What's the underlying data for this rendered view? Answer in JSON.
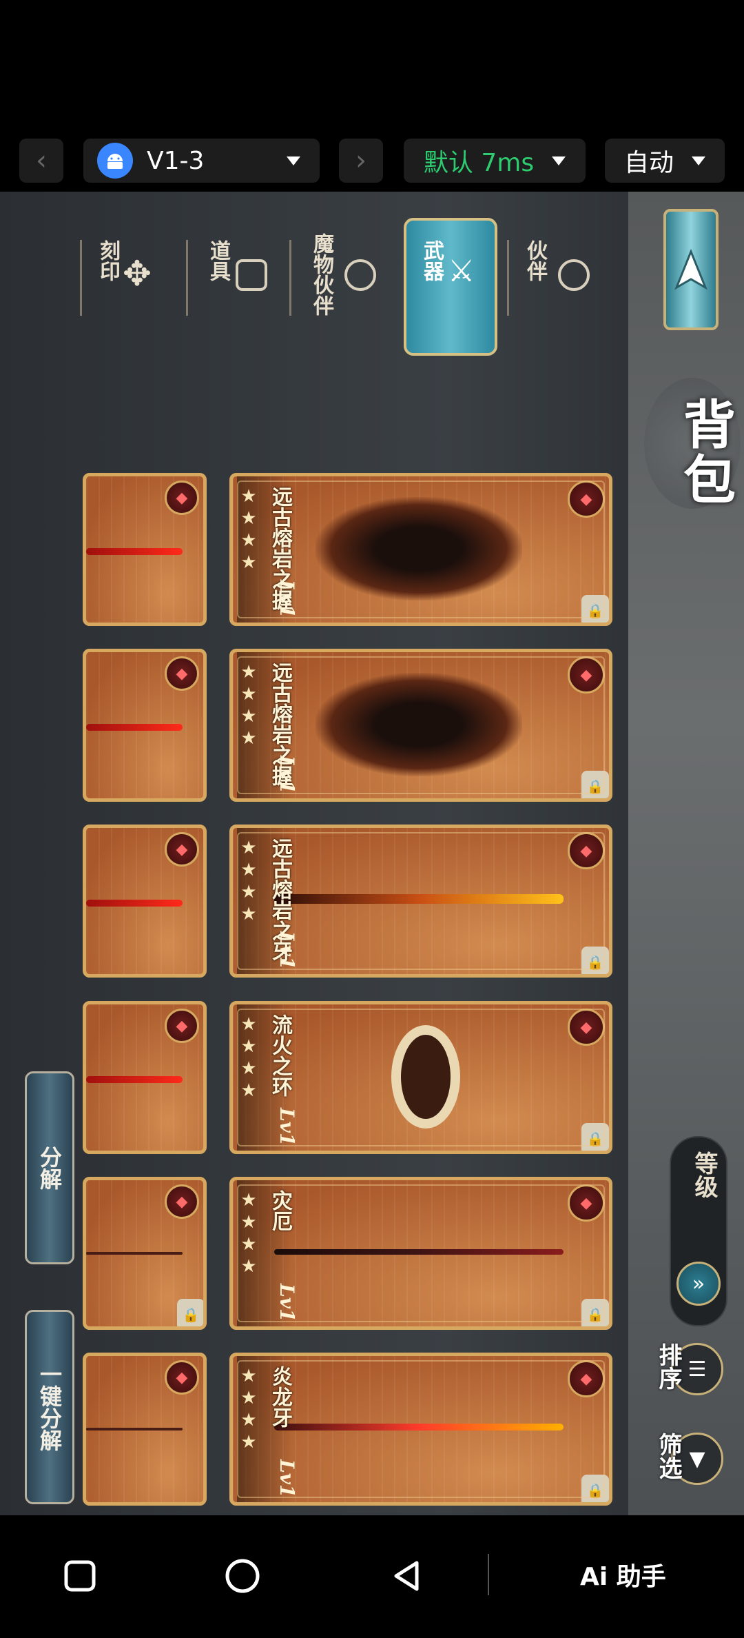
{
  "toolbar": {
    "prev_icon": "chevron-left-icon",
    "next_icon": "chevron-right-icon",
    "device": "V1-3",
    "latency": "默认 7ms",
    "mode": "自动"
  },
  "game": {
    "title": "背包",
    "tabs": [
      {
        "label": "伙伴",
        "icon": "partner-icon"
      },
      {
        "label": "武器",
        "icon": "crossed-swords-icon",
        "selected": true
      },
      {
        "label": "魔物伙伴",
        "icon": "beast-icon"
      },
      {
        "label": "道具",
        "icon": "item-icon"
      },
      {
        "label": "刻印",
        "icon": "rune-icon"
      }
    ],
    "sort": {
      "level_label": "等级",
      "sort_label": "排序",
      "filter_label": "筛选"
    },
    "items": [
      {
        "name": "远古熔岩之握",
        "level": "Lv1",
        "stars": "★★★★",
        "art": "gauntlet",
        "locked": true
      },
      {
        "name": "远古熔岩之握",
        "level": "Lv1",
        "stars": "★★★★",
        "art": "gauntlet",
        "locked": true
      },
      {
        "name": "远古熔岩之牙",
        "level": "Lv1",
        "stars": "★★★★",
        "art": "blade",
        "locked": true
      },
      {
        "name": "流火之环",
        "level": "Lv1",
        "stars": "★★★★",
        "art": "ring",
        "locked": true
      },
      {
        "name": "灾厄",
        "level": "Lv1",
        "stars": "★★★★",
        "art": "scythe",
        "locked": true
      },
      {
        "name": "炎龙牙",
        "level": "Lv1",
        "stars": "★★★★",
        "art": "sword",
        "locked": true
      }
    ],
    "buttons": {
      "dismantle": "分解",
      "one_click_dismantle": "一键分解"
    }
  },
  "navbar": {
    "recents_icon": "square-icon",
    "home_icon": "circle-icon",
    "back_icon": "triangle-back-icon",
    "assistant": "Ai 助手"
  }
}
